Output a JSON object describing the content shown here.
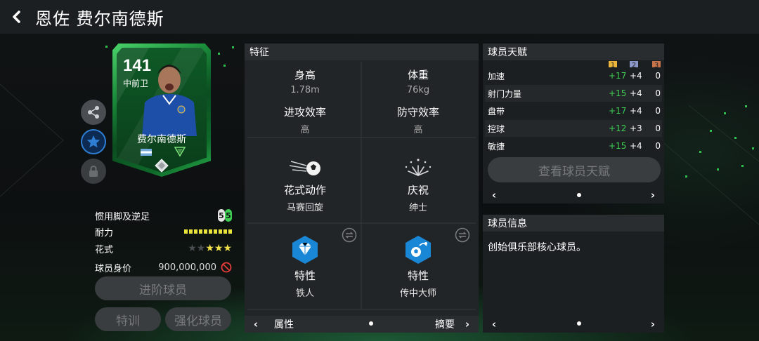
{
  "header": {
    "title": "恩佐 费尔南德斯"
  },
  "card": {
    "rating": "141",
    "position": "中前卫",
    "name": "费尔南德斯"
  },
  "info": {
    "foot_label": "惯用脚及逆足",
    "foot_left": "5",
    "foot_right": "5",
    "stamina_label": "耐力",
    "stamina_value": 1.0,
    "skill_label": "花式",
    "skill_stars_filled": 3,
    "skill_stars_total": 5,
    "price_label": "球员身价",
    "price_value": "900,000,000"
  },
  "actions": {
    "advance": "进阶球员",
    "train": "特训",
    "enhance": "强化球员"
  },
  "traits": {
    "title": "特征",
    "height_label": "身高",
    "height_value": "1.78m",
    "weight_label": "体重",
    "weight_value": "76kg",
    "attack_label": "进攻效率",
    "attack_value": "高",
    "defense_label": "防守效率",
    "defense_value": "高",
    "skill_move_label": "花式动作",
    "skill_move_value": "马赛回旋",
    "celebration_label": "庆祝",
    "celebration_value": "绅士",
    "trait1_label": "特性",
    "trait1_value": "铁人",
    "trait2_label": "特性",
    "trait2_value": "传中大师",
    "pager_left": "属性",
    "pager_right": "摘要"
  },
  "talent": {
    "title": "球员天赋",
    "ranks": [
      "1",
      "2",
      "3"
    ],
    "rows": [
      {
        "name": "加速",
        "v1": "+17",
        "v2": "+4",
        "v3": "0"
      },
      {
        "name": "射门力量",
        "v1": "+15",
        "v2": "+4",
        "v3": "0"
      },
      {
        "name": "盘带",
        "v1": "+17",
        "v2": "+4",
        "v3": "0"
      },
      {
        "name": "控球",
        "v1": "+12",
        "v2": "+3",
        "v3": "0"
      },
      {
        "name": "敏捷",
        "v1": "+15",
        "v2": "+4",
        "v3": "0"
      }
    ],
    "view_button": "查看球员天赋"
  },
  "player_info": {
    "title": "球员信息",
    "text": "创始俱乐部核心球员。"
  },
  "colors": {
    "accent_green": "#3fcf55",
    "rank1": "#e9b53a",
    "rank2": "#8c97c9",
    "rank3": "#c8744a",
    "favorite_blue": "#2e7fd4"
  }
}
